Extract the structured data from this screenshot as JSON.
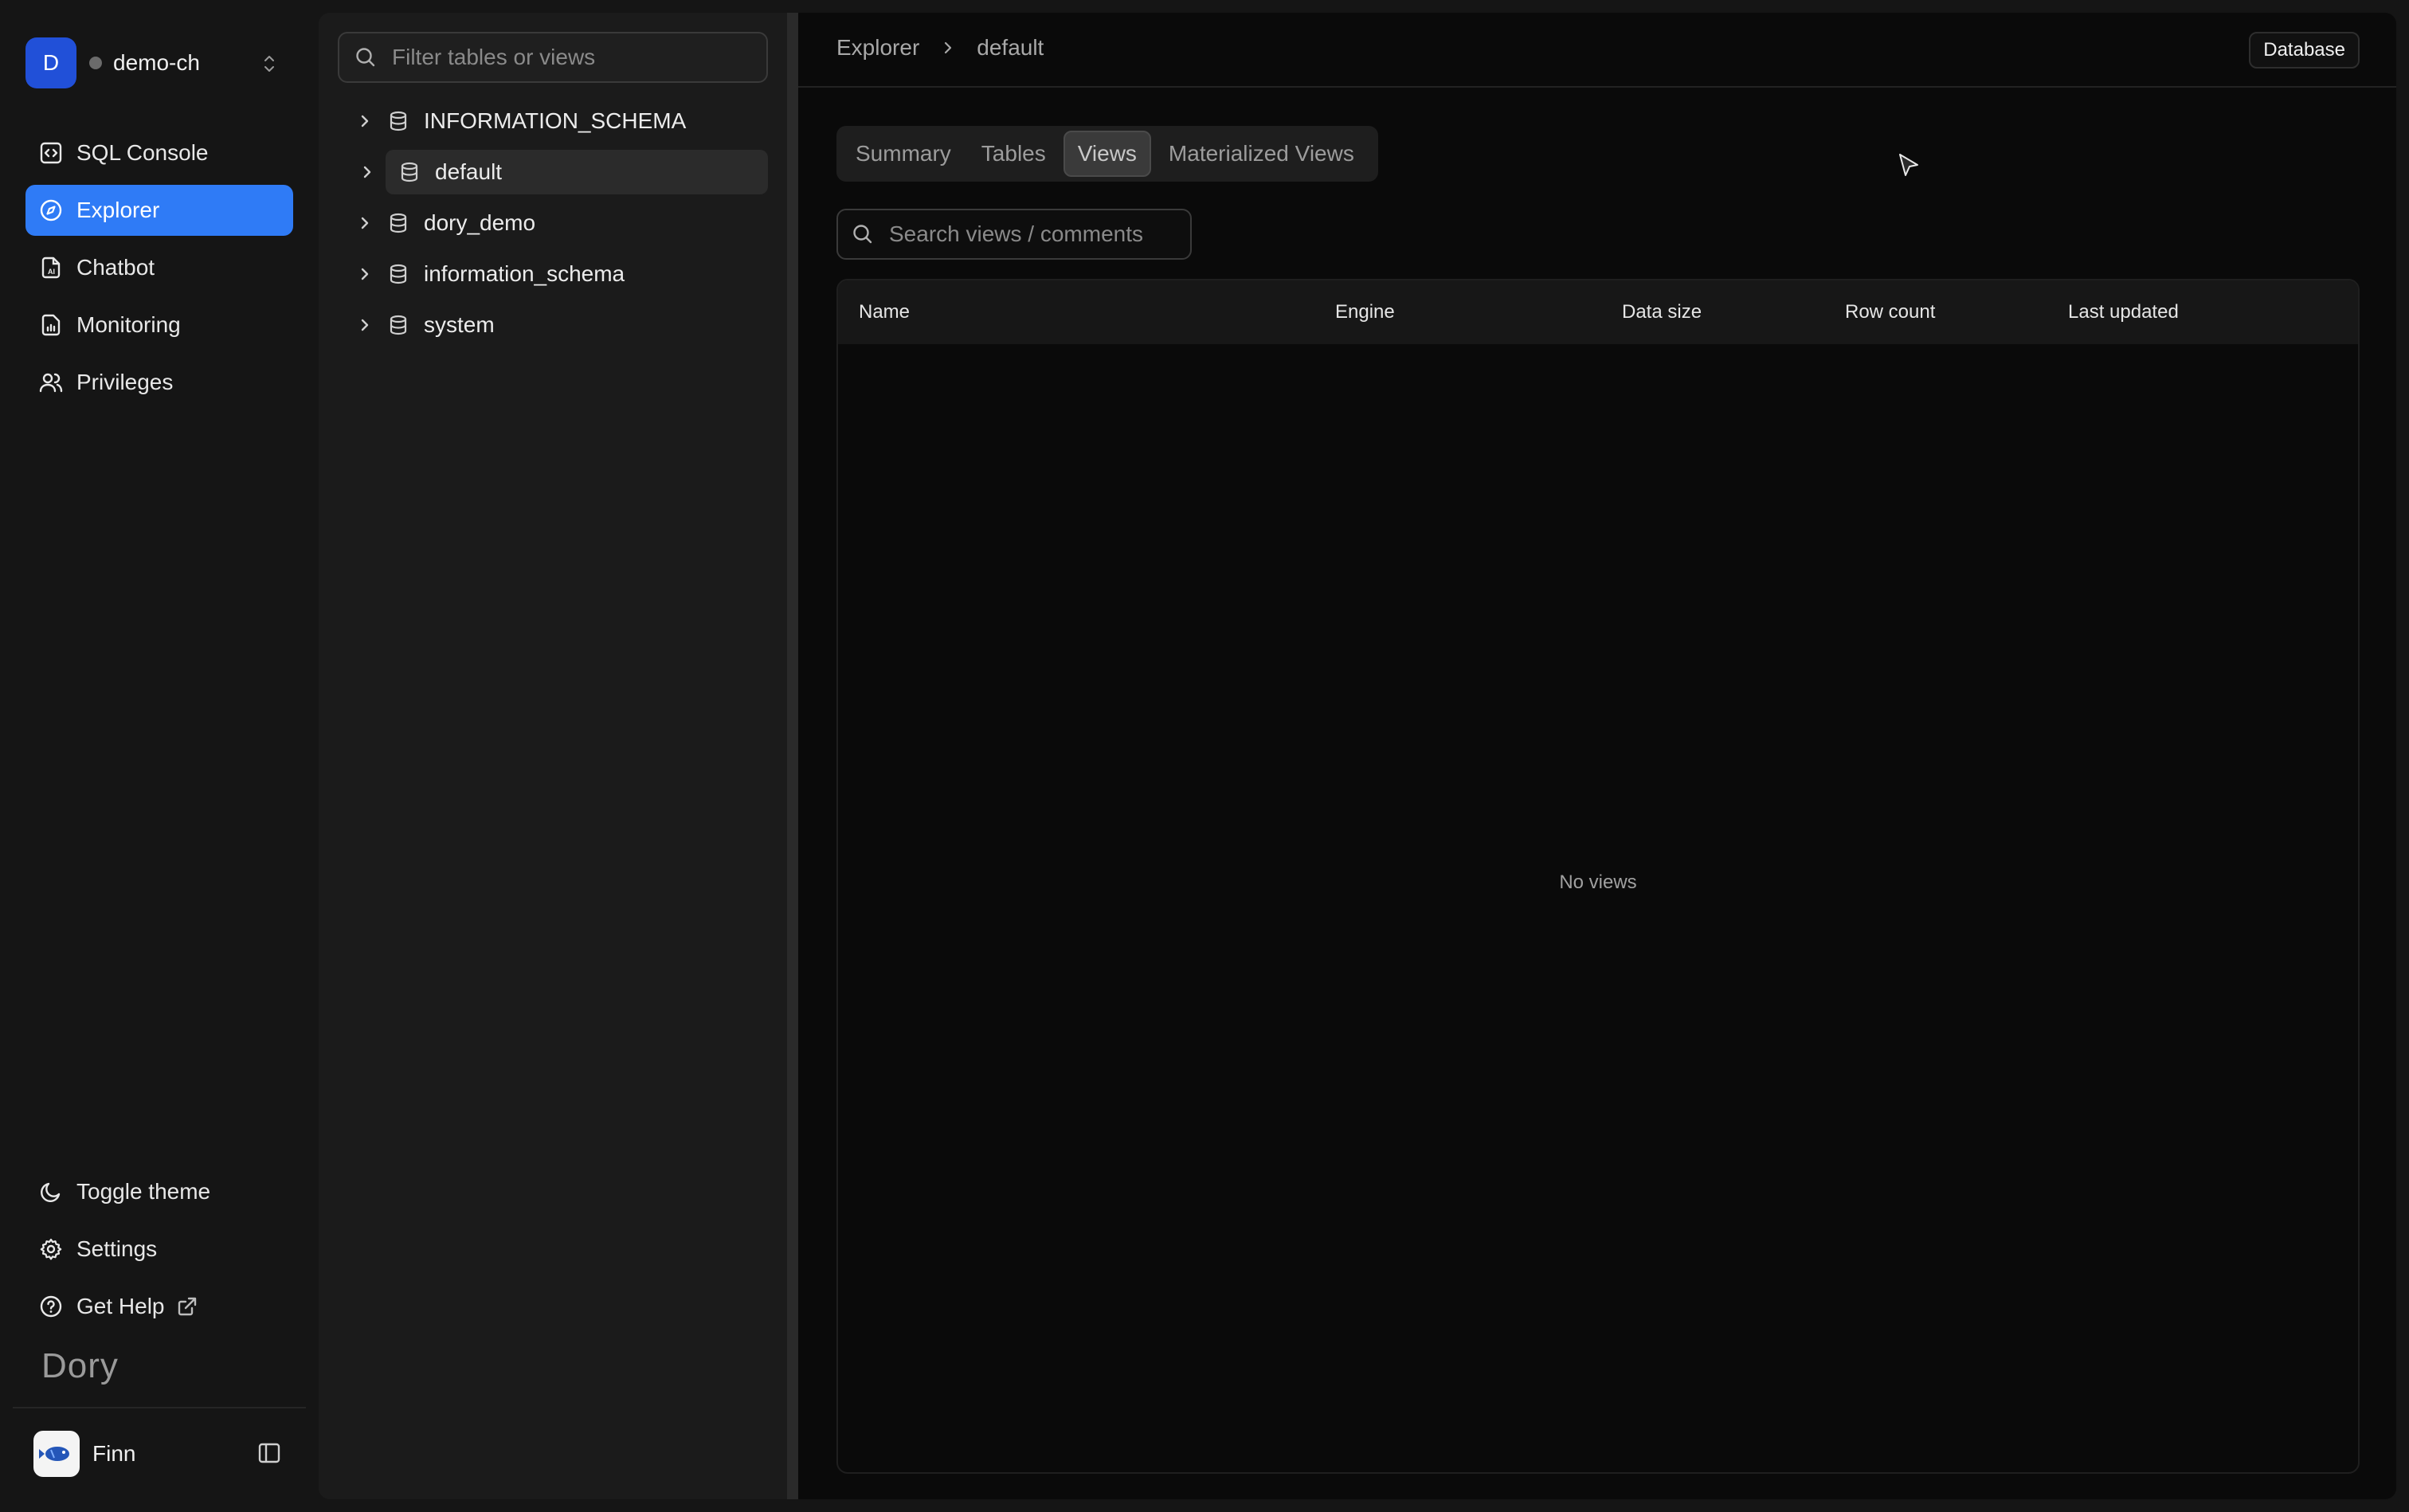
{
  "workspace": {
    "avatar_letter": "D",
    "name": "demo-ch"
  },
  "nav": {
    "items": [
      {
        "label": "SQL Console",
        "icon": "code-square-icon"
      },
      {
        "label": "Explorer",
        "icon": "compass-icon",
        "active": true
      },
      {
        "label": "Chatbot",
        "icon": "file-ai-icon"
      },
      {
        "label": "Monitoring",
        "icon": "chart-file-icon"
      },
      {
        "label": "Privileges",
        "icon": "users-icon"
      }
    ],
    "bottom": [
      {
        "label": "Toggle theme",
        "icon": "moon-icon"
      },
      {
        "label": "Settings",
        "icon": "gear-icon"
      },
      {
        "label": "Get Help",
        "icon": "help-circle-icon"
      }
    ]
  },
  "brand": "Dory",
  "user": {
    "name": "Finn"
  },
  "tree": {
    "filter_placeholder": "Filter tables or views",
    "databases": [
      "INFORMATION_SCHEMA",
      "default",
      "dory_demo",
      "information_schema",
      "system"
    ],
    "selected": "default"
  },
  "breadcrumb": {
    "root": "Explorer",
    "current": "default"
  },
  "badge": "Database",
  "tabs": [
    "Summary",
    "Tables",
    "Views",
    "Materialized Views"
  ],
  "active_tab": "Views",
  "search": {
    "placeholder": "Search views / comments"
  },
  "table": {
    "columns": [
      "Name",
      "Engine",
      "Data size",
      "Row count",
      "Last updated"
    ],
    "empty_text": "No views"
  },
  "colors": {
    "accent": "#2f7bf6",
    "avatar": "#2150d8"
  }
}
